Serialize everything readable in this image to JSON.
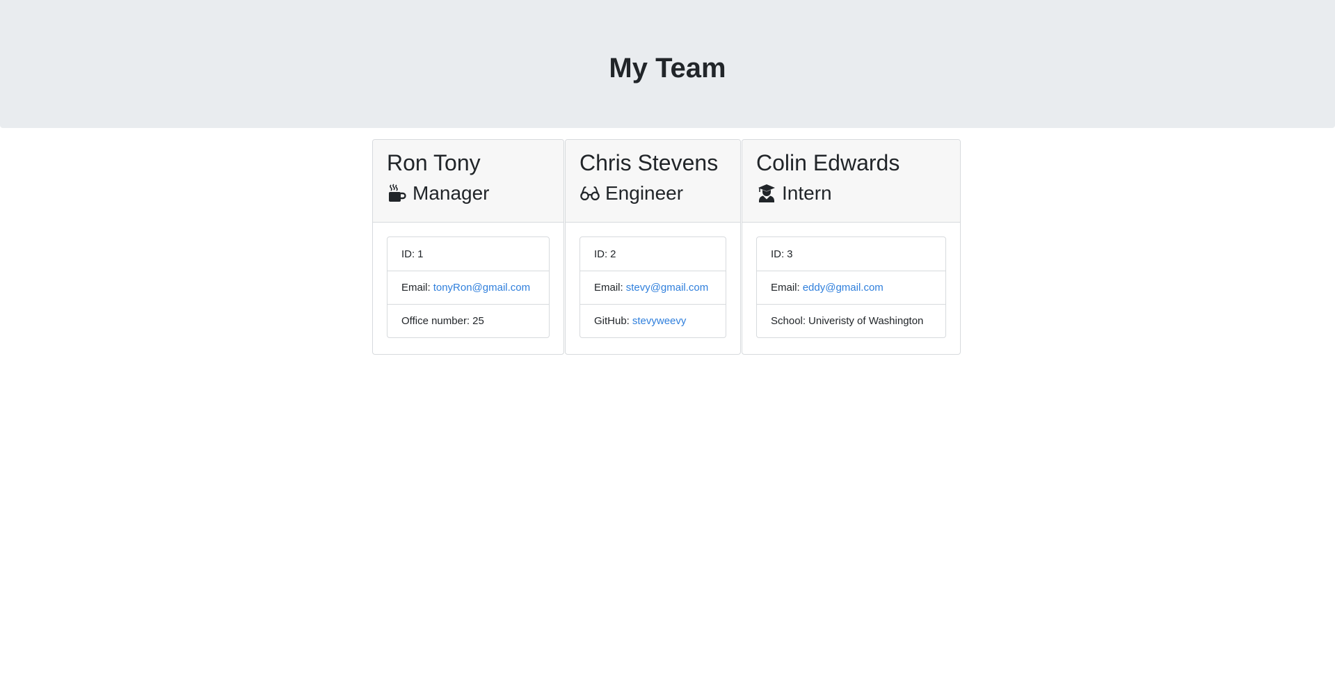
{
  "header": {
    "title": "My Team"
  },
  "team": [
    {
      "name": "Ron Tony",
      "role": "Manager",
      "role_icon": "coffee-mug-icon",
      "details": [
        {
          "label": "ID:",
          "value": "1",
          "is_link": false
        },
        {
          "label": "Email:",
          "value": "tonyRon@gmail.com",
          "is_link": true
        },
        {
          "label": "Office number:",
          "value": "25",
          "is_link": false
        }
      ]
    },
    {
      "name": "Chris Stevens",
      "role": "Engineer",
      "role_icon": "glasses-icon",
      "details": [
        {
          "label": "ID:",
          "value": "2",
          "is_link": false
        },
        {
          "label": "Email:",
          "value": "stevy@gmail.com",
          "is_link": true
        },
        {
          "label": "GitHub:",
          "value": "stevyweevy",
          "is_link": true
        }
      ]
    },
    {
      "name": "Colin Edwards",
      "role": "Intern",
      "role_icon": "graduate-icon",
      "details": [
        {
          "label": "ID:",
          "value": "3",
          "is_link": false
        },
        {
          "label": "Email:",
          "value": "eddy@gmail.com",
          "is_link": true
        },
        {
          "label": "School:",
          "value": "Univeristy of Washington",
          "is_link": false
        }
      ]
    }
  ],
  "colors": {
    "header_bg": "#e9ecef",
    "card_header_bg": "#f7f7f7",
    "link": "#2f7fdc",
    "text": "#212529",
    "border": "#d7dadd"
  }
}
